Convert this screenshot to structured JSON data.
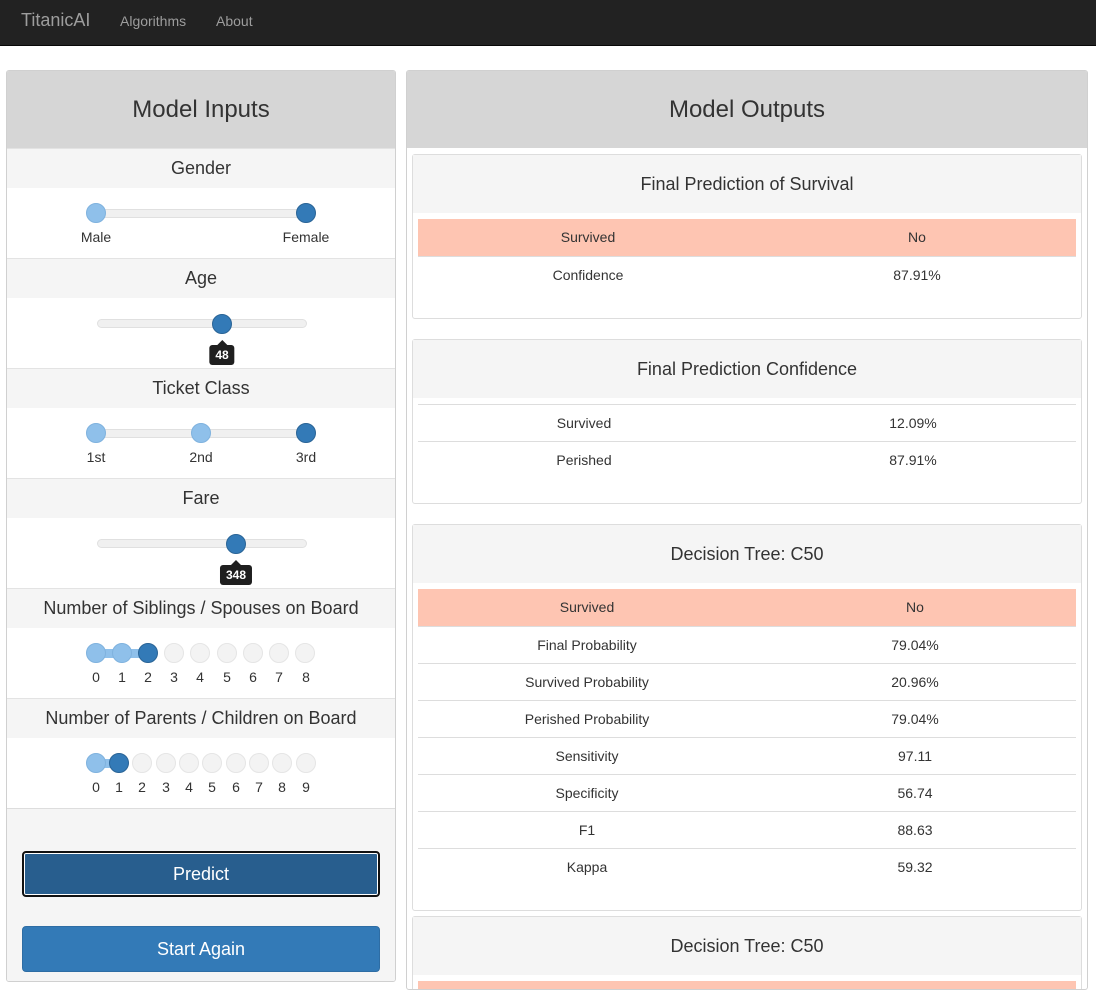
{
  "nav": {
    "brand": "TitanicAI",
    "links": [
      "Algorithms",
      "About"
    ]
  },
  "inputs": {
    "title": "Model Inputs",
    "gender": {
      "label": "Gender",
      "options": [
        "Male",
        "Female"
      ],
      "selected": "Female"
    },
    "age": {
      "label": "Age",
      "value": "48"
    },
    "ticket_class": {
      "label": "Ticket Class",
      "options": [
        "1st",
        "2nd",
        "3rd"
      ],
      "selected": "3rd"
    },
    "fare": {
      "label": "Fare",
      "value": "348"
    },
    "siblings": {
      "label": "Number of Siblings / Spouses on Board",
      "ticks": [
        "0",
        "1",
        "2",
        "3",
        "4",
        "5",
        "6",
        "7",
        "8"
      ],
      "selected": "2"
    },
    "parents": {
      "label": "Number of Parents / Children on Board",
      "ticks": [
        "0",
        "1",
        "2",
        "3",
        "4",
        "5",
        "6",
        "7",
        "8",
        "9"
      ],
      "selected": "1"
    },
    "predict_label": "Predict",
    "start_again_label": "Start Again"
  },
  "outputs": {
    "title": "Model Outputs",
    "final_prediction": {
      "title": "Final Prediction of Survival",
      "header": [
        "Survived",
        "No"
      ],
      "rows": [
        [
          "Confidence",
          "87.91%"
        ]
      ]
    },
    "confidence": {
      "title": "Final Prediction Confidence",
      "rows": [
        [
          "Survived",
          "12.09%"
        ],
        [
          "Perished",
          "87.91%"
        ]
      ]
    },
    "c50": {
      "title": "Decision Tree: C50",
      "header": [
        "Survived",
        "No"
      ],
      "rows": [
        [
          "Final Probability",
          "79.04%"
        ],
        [
          "Survived Probability",
          "20.96%"
        ],
        [
          "Perished Probability",
          "79.04%"
        ],
        [
          "Sensitivity",
          "97.11"
        ],
        [
          "Specificity",
          "56.74"
        ],
        [
          "F1",
          "88.63"
        ],
        [
          "Kappa",
          "59.32"
        ]
      ]
    },
    "c50_second": {
      "title": "Decision Tree: C50"
    }
  }
}
